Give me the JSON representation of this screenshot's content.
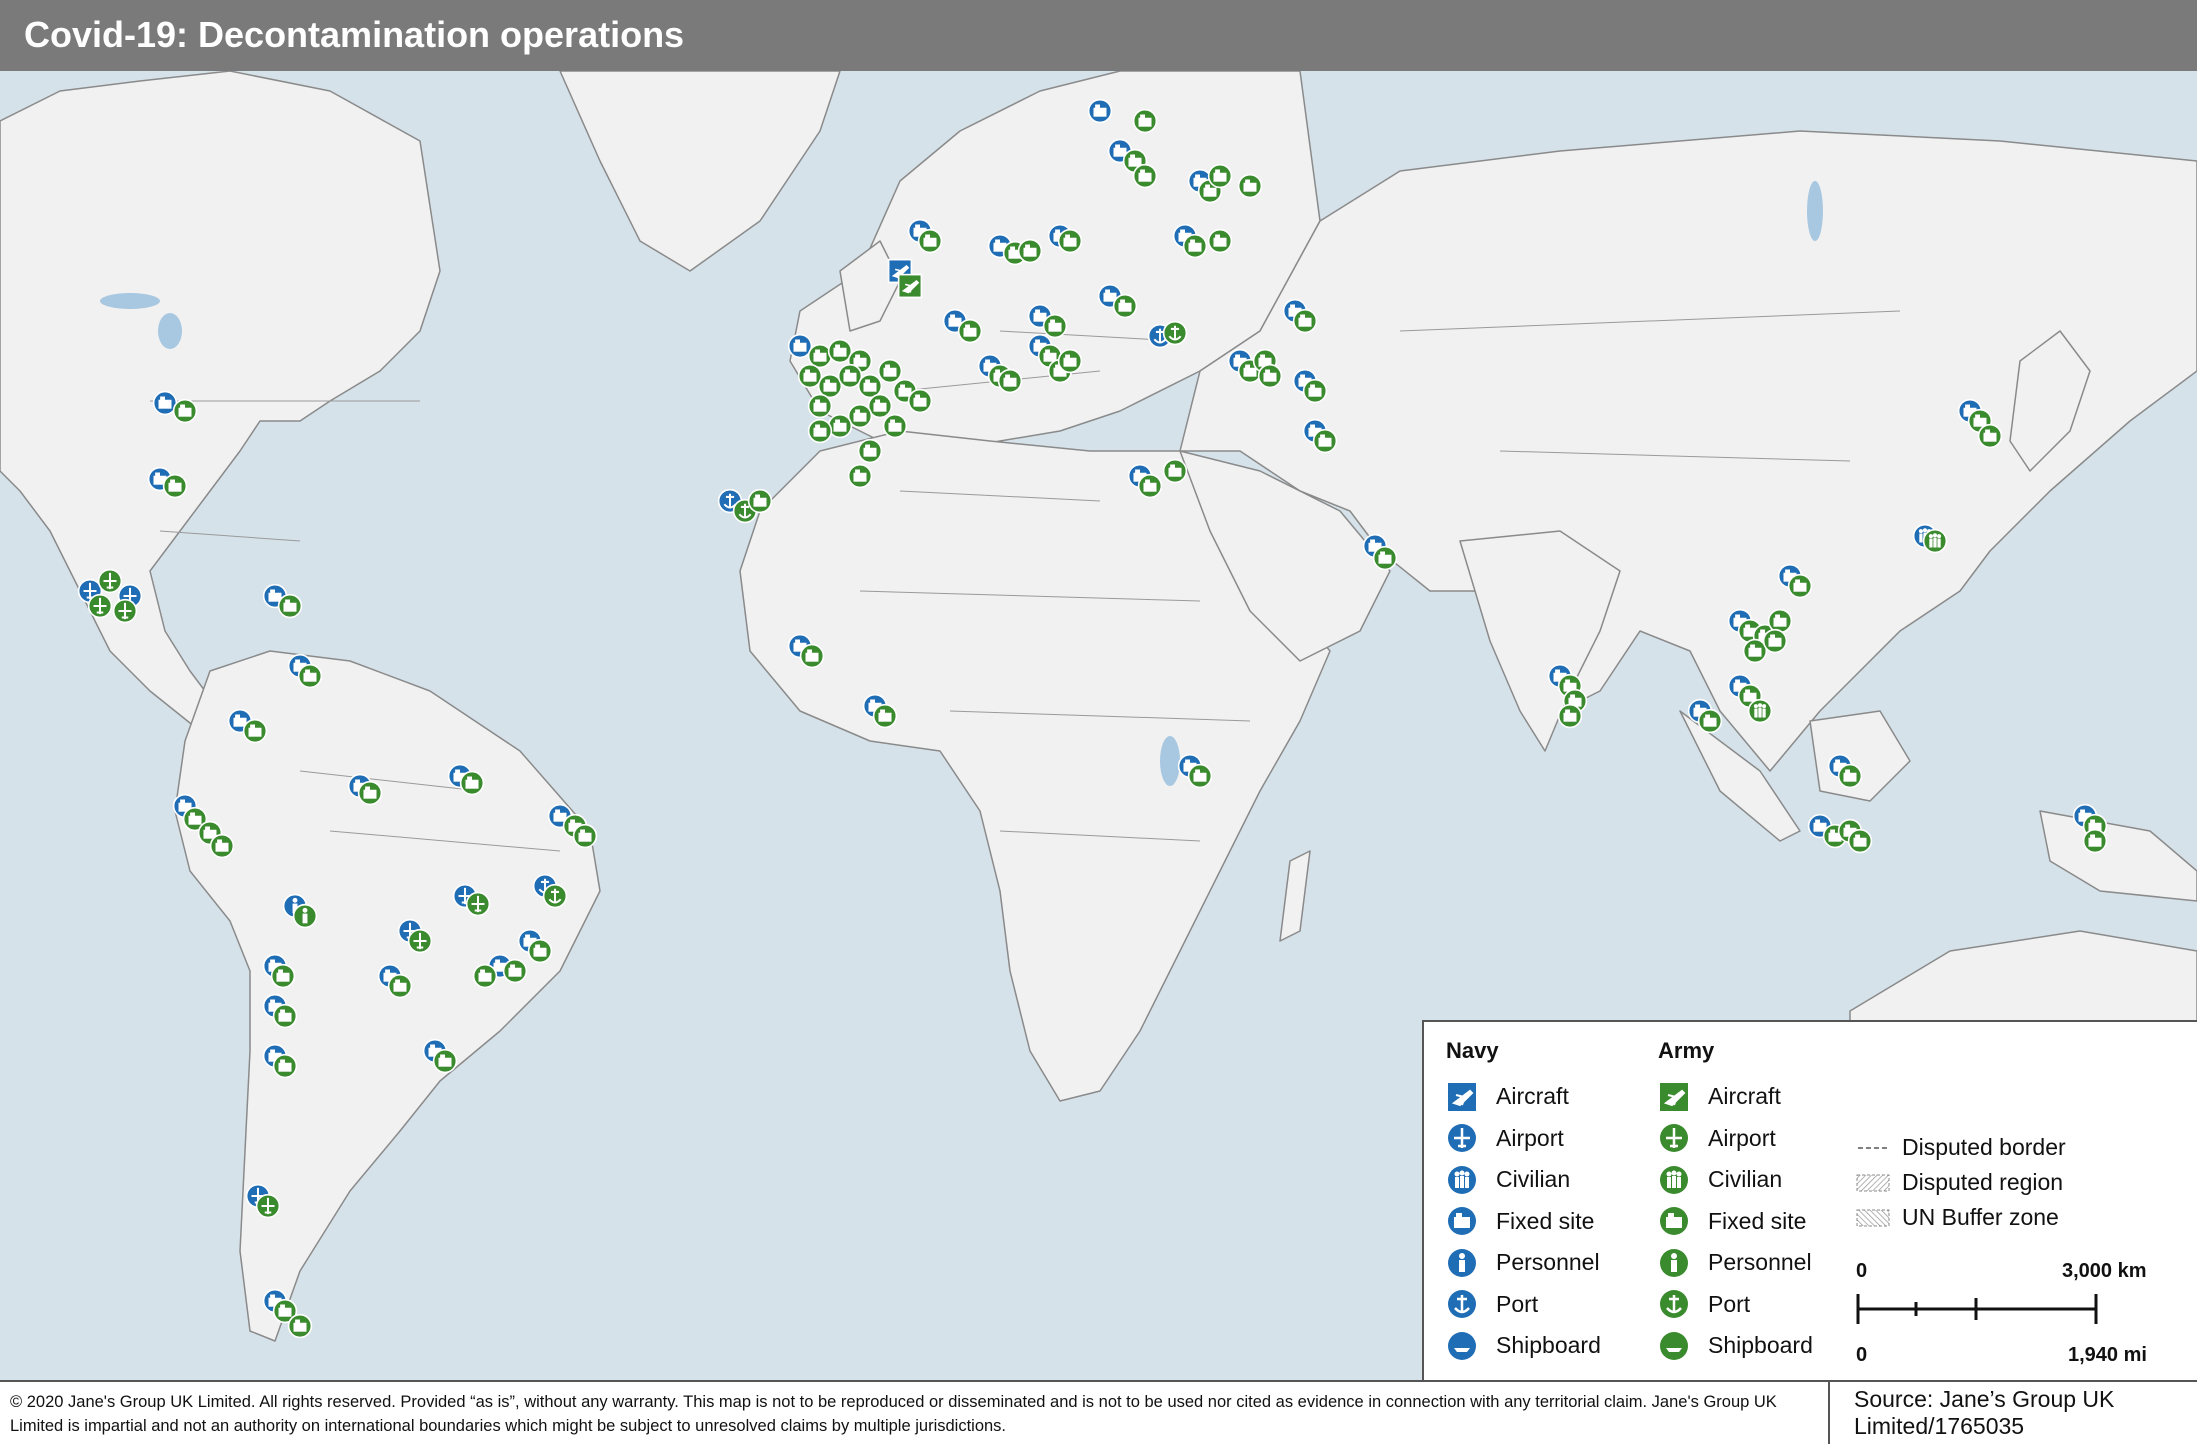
{
  "title": "Covid-19: Decontamination operations",
  "colors": {
    "navy": "#1f6db5",
    "army": "#3a8a2e",
    "sea": "#d6e2ea",
    "land": "#f1f1f1",
    "border": "#8a8a8a",
    "header": "#7a7a7a"
  },
  "legend": {
    "navy_heading": "Navy",
    "army_heading": "Army",
    "items": [
      {
        "label": "Aircraft",
        "icon": "aircraft-icon"
      },
      {
        "label": "Airport",
        "icon": "airport-icon"
      },
      {
        "label": "Civilian",
        "icon": "civilian-icon"
      },
      {
        "label": "Fixed site",
        "icon": "fixed-site-icon"
      },
      {
        "label": "Personnel",
        "icon": "personnel-icon"
      },
      {
        "label": "Port",
        "icon": "port-icon"
      },
      {
        "label": "Shipboard",
        "icon": "shipboard-icon"
      }
    ],
    "extra": [
      {
        "label": "Disputed border"
      },
      {
        "label": "Disputed region"
      },
      {
        "label": "UN Buffer zone"
      }
    ]
  },
  "scale": {
    "km_zero": "0",
    "km_label": "3,000 km",
    "mi_zero": "0",
    "mi_label": "1,940 mi"
  },
  "footer": {
    "copyright": "© 2020 Jane's Group UK Limited. All rights reserved. Provided “as is”, without any warranty. This map is not to be reproduced or disseminated and is not to be used nor cited as evidence in connection with any territorial claim. Jane's Group UK Limited is impartial and not an authority on international boundaries which might be subject to unresolved claims by multiple jurisdictions.",
    "source": "Source: Jane’s Group UK Limited/1765035"
  }
}
